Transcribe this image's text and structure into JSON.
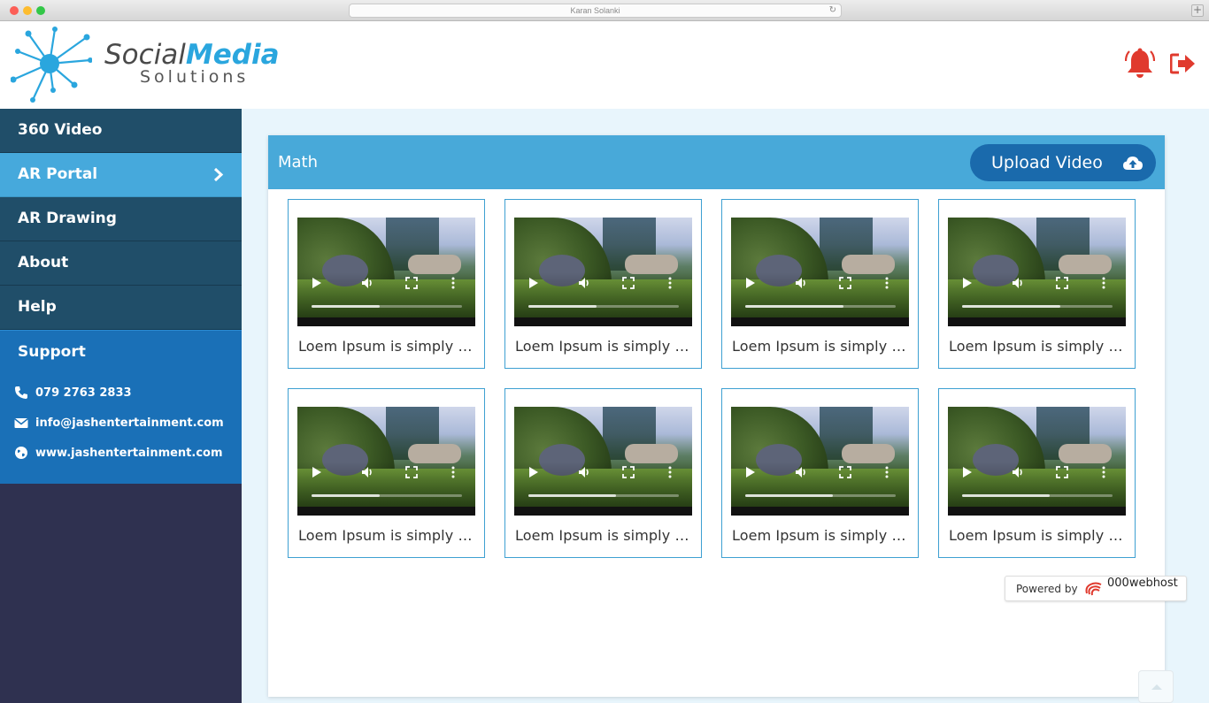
{
  "browser": {
    "url_text": "Karan Solanki",
    "new_tab": "+"
  },
  "header": {
    "logo_word1": "Social",
    "logo_word2": "Media",
    "logo_line2": "Solutions",
    "bell_icon": "bell-icon",
    "logout_icon": "logout-icon",
    "accent_color": "#e03a2e"
  },
  "sidebar": {
    "items": [
      {
        "label": "360 Video",
        "active": false
      },
      {
        "label": "AR Portal",
        "active": true
      },
      {
        "label": "AR Drawing",
        "active": false
      },
      {
        "label": "About",
        "active": false
      },
      {
        "label": "Help",
        "active": false
      }
    ],
    "support": {
      "title": "Support",
      "phone": "079 2763 2833",
      "email": "info@jashentertainment.com",
      "website": "www.jashentertainment.com"
    }
  },
  "main": {
    "title": "Math",
    "upload_label": "Upload Video",
    "videos": [
      {
        "caption": "Loem Ipsum is simply dummy text",
        "progress": 0.45
      },
      {
        "caption": "Loem Ipsum is simply dummy text",
        "progress": 0.45
      },
      {
        "caption": "Loem Ipsum is simply dummy text",
        "progress": 0.65
      },
      {
        "caption": "Loem Ipsum is simply dummy text",
        "progress": 0.65
      },
      {
        "caption": "Loem Ipsum is simply dummy text",
        "progress": 0.45
      },
      {
        "caption": "Loem Ipsum is simply dummy text",
        "progress": 0.58
      },
      {
        "caption": "Loem Ipsum is simply dummy text",
        "progress": 0.58
      },
      {
        "caption": "Loem Ipsum is simply dummy text",
        "progress": 0.58
      }
    ]
  },
  "footer": {
    "powered_by": "Powered by",
    "host_brand": "000webhost"
  }
}
